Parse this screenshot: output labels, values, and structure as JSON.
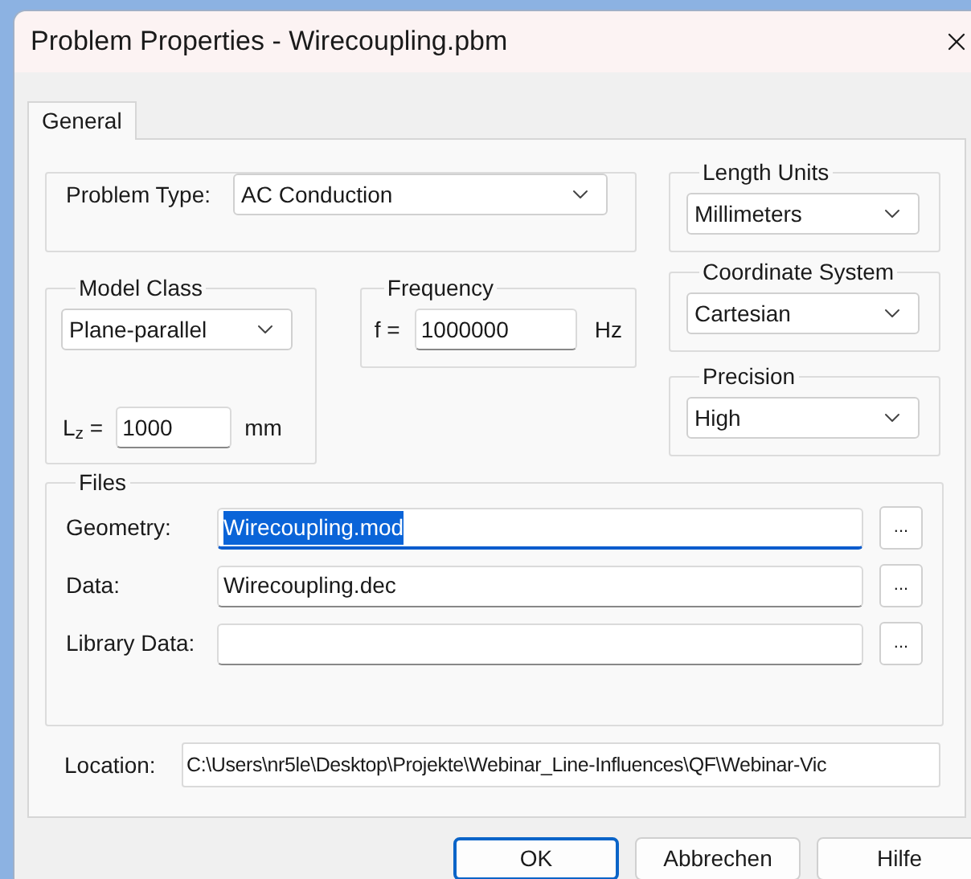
{
  "window": {
    "title": "Problem Properties - Wirecoupling.pbm"
  },
  "tabs": [
    {
      "label": "General",
      "selected": true
    }
  ],
  "problem_type": {
    "label": "Problem Type:",
    "value": "AC Conduction"
  },
  "length_units": {
    "legend": "Length Units",
    "value": "Millimeters"
  },
  "model_class": {
    "legend": "Model Class",
    "value": "Plane-parallel",
    "depth_label": "L$_{z}$ =",
    "depth_value": "1000",
    "depth_unit": "mm"
  },
  "frequency": {
    "legend": "Frequency",
    "label": "f =",
    "value": "1000000",
    "unit": "Hz"
  },
  "coordinate_system": {
    "legend": "Coordinate System",
    "value": "Cartesian"
  },
  "precision": {
    "legend": "Precision",
    "value": "High"
  },
  "files": {
    "legend": "Files",
    "rows": [
      {
        "label": "Geometry:",
        "value": "Wirecoupling.mod",
        "focused": true,
        "browse": "..."
      },
      {
        "label": "Data:",
        "value": "Wirecoupling.dec",
        "focused": false,
        "browse": "..."
      },
      {
        "label": "Library Data:",
        "focused": false,
        "browse": "..."
      }
    ]
  },
  "location": {
    "label": "Location:",
    "value": "C:\\Users\\nr5le\\Desktop\\Projekte\\Webinar_Line-Influences\\QF\\Webinar-Vic"
  },
  "buttons": [
    {
      "label": "OK",
      "default": true
    },
    {
      "label": "Abbrechen",
      "default": false
    },
    {
      "label": "Hilfe",
      "default": false
    }
  ]
}
